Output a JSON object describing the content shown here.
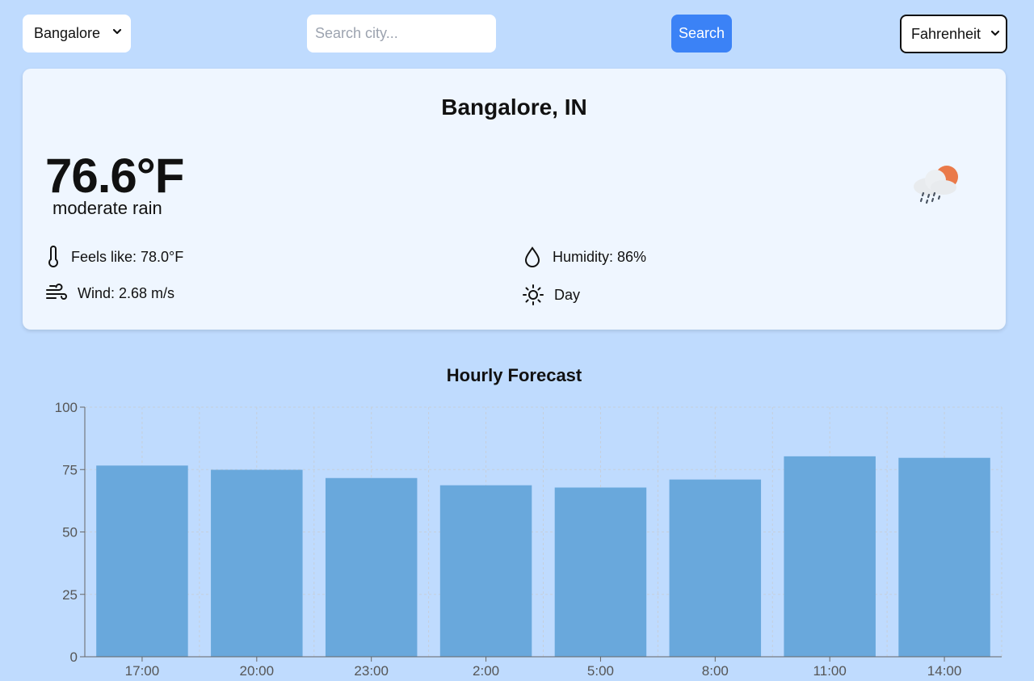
{
  "topbar": {
    "city_select_value": "Bangalore",
    "search_placeholder": "Search city...",
    "search_button_label": "Search",
    "unit_select_value": "Fahrenheit"
  },
  "current": {
    "location": "Bangalore, IN",
    "temperature": "76.6°F",
    "description": "moderate rain",
    "condition_icon": "cloud-sun-rain-icon",
    "feels_like": "Feels like: 78.0°F",
    "humidity": "Humidity: 86%",
    "wind": "Wind: 2.68 m/s",
    "day_night": "Day"
  },
  "colors": {
    "background": "#bfdbfe",
    "card": "#eff6ff",
    "accent": "#3b82f6",
    "bar": "#69a8dc",
    "sun": "#ea7a4a"
  },
  "chart_data": {
    "type": "bar",
    "title": "Hourly Forecast",
    "categories": [
      "17:00",
      "20:00",
      "23:00",
      "2:00",
      "5:00",
      "8:00",
      "11:00",
      "14:00"
    ],
    "values": [
      76.6,
      74.9,
      71.6,
      68.7,
      67.8,
      71.0,
      80.3,
      79.7
    ],
    "ylim": [
      0,
      100
    ],
    "yticks": [
      0,
      25,
      50,
      75,
      100
    ],
    "grid": true
  }
}
